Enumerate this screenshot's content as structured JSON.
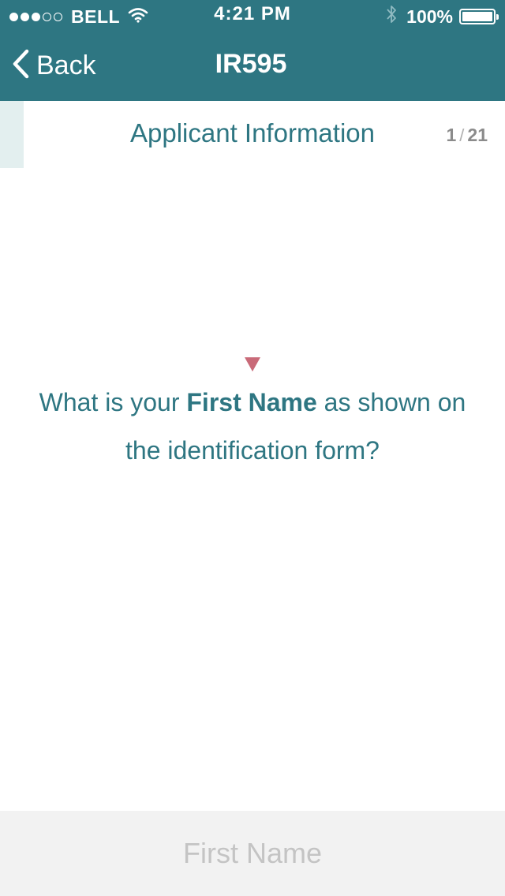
{
  "status_bar": {
    "carrier": "BELL",
    "signal_bars_full": 3,
    "signal_bars_total": 5,
    "time": "4:21 PM",
    "battery_percent": "100%",
    "icons": [
      "wifi-icon",
      "bluetooth-icon",
      "battery-icon"
    ]
  },
  "nav": {
    "back_label": "Back",
    "title": "IR595"
  },
  "section": {
    "title": "Applicant Information",
    "step_current": "1",
    "step_separator": "/",
    "step_total": "21"
  },
  "question": {
    "prefix": "What is your ",
    "emphasis": "First Name",
    "suffix": " as shown on the identification form?"
  },
  "input": {
    "placeholder": "First Name",
    "value": ""
  },
  "colors": {
    "brand": "#2e7682",
    "accent": "#c96a78",
    "input_bar": "#f2f2f2",
    "progress_tint": "#e3efef"
  }
}
